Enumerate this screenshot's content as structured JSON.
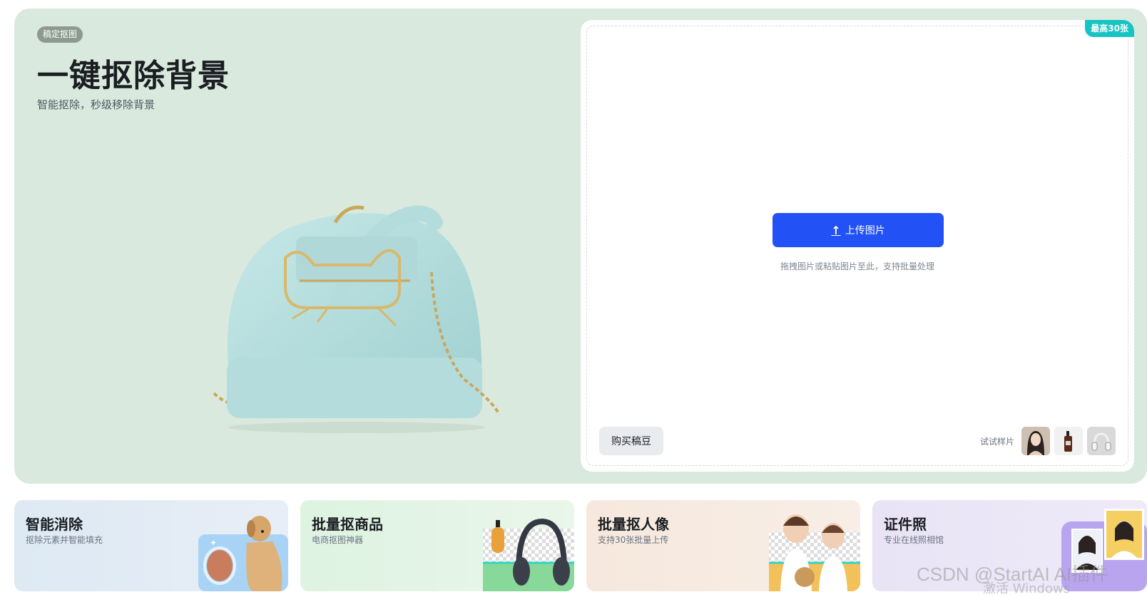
{
  "hero": {
    "tag": "稿定抠图",
    "title": "一键抠除背景",
    "subtitle": "智能抠除，秒级移除背景"
  },
  "upload": {
    "limit_badge": "最高30张",
    "button_label": "上传图片",
    "button_icon": "upload-arrow-icon",
    "hint": "拖拽图片或粘贴图片至此，支持批量处理",
    "buy_label": "购买稿豆",
    "samples_label": "试试样片",
    "samples": [
      "portrait-woman",
      "bottle-product",
      "headphones-product"
    ]
  },
  "features": [
    {
      "title": "智能消除",
      "subtitle": "抠除元素并智能填充"
    },
    {
      "title": "批量抠商品",
      "subtitle": "电商抠图神器"
    },
    {
      "title": "批量抠人像",
      "subtitle": "支持30张批量上传"
    },
    {
      "title": "证件照",
      "subtitle": "专业在线照相馆"
    }
  ],
  "overlay": {
    "watermark": "CSDN @StartAI AI插件",
    "activation": "激活 Windows"
  },
  "colors": {
    "hero_bg": "#d9e9dd",
    "primary": "#2251f5",
    "badge": "#16c4c4"
  }
}
